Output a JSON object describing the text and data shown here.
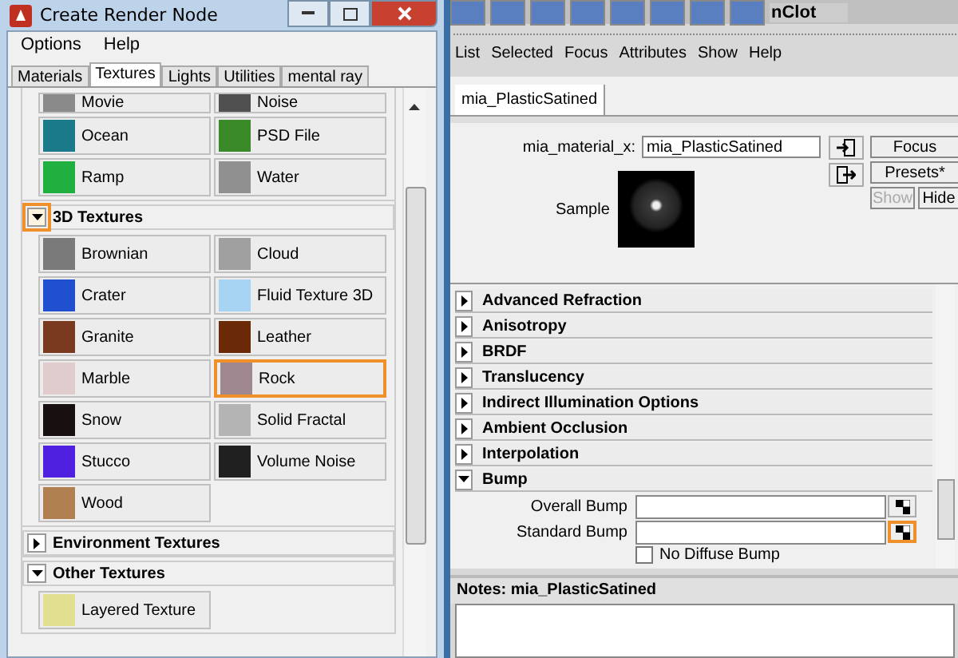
{
  "render_node_window": {
    "title": "Create Render Node",
    "menu": [
      "Options",
      "Help"
    ],
    "tabs": [
      {
        "label": "Materials",
        "selected": false
      },
      {
        "label": "Textures",
        "selected": true
      },
      {
        "label": "Lights",
        "selected": false
      },
      {
        "label": "Utilities",
        "selected": false
      },
      {
        "label": "mental ray",
        "selected": false
      }
    ],
    "sections": [
      {
        "tiles": [
          {
            "label": "Movie",
            "color": "#8a8a8a",
            "clipped": true,
            "highlighted": false
          },
          {
            "label": "Noise",
            "color": "#505050",
            "clipped": true,
            "highlighted": false
          },
          {
            "label": "Ocean",
            "color": "#1a7a8a",
            "clipped": false,
            "highlighted": false
          },
          {
            "label": "PSD File",
            "color": "#3a8a2a",
            "clipped": false,
            "highlighted": false
          },
          {
            "label": "Ramp",
            "color": "#20b040",
            "clipped": false,
            "highlighted": false
          },
          {
            "label": "Water",
            "color": "#909090",
            "clipped": false,
            "highlighted": false
          }
        ]
      },
      {
        "title": "3D Textures",
        "expanded": true,
        "highlighted": true,
        "tiles": [
          {
            "label": "Brownian",
            "color": "#7a7a7a",
            "clipped": false,
            "highlighted": false
          },
          {
            "label": "Cloud",
            "color": "#a0a0a0",
            "clipped": false,
            "highlighted": false
          },
          {
            "label": "Crater",
            "color": "#2050d0",
            "clipped": false,
            "highlighted": false
          },
          {
            "label": "Fluid Texture 3D",
            "color": "#a8d4f4",
            "clipped": false,
            "highlighted": false
          },
          {
            "label": "Granite",
            "color": "#7a3a20",
            "clipped": false,
            "highlighted": false
          },
          {
            "label": "Leather",
            "color": "#6a2a08",
            "clipped": false,
            "highlighted": false
          },
          {
            "label": "Marble",
            "color": "#e0cccc",
            "clipped": false,
            "highlighted": false
          },
          {
            "label": "Rock",
            "color": "#a08890",
            "clipped": false,
            "highlighted": true
          },
          {
            "label": "Snow",
            "color": "#181010",
            "clipped": false,
            "highlighted": false
          },
          {
            "label": "Solid Fractal",
            "color": "#b4b4b4",
            "clipped": false,
            "highlighted": false
          },
          {
            "label": "Stucco",
            "color": "#5020e0",
            "clipped": false,
            "highlighted": false
          },
          {
            "label": "Volume Noise",
            "color": "#202020",
            "clipped": false,
            "highlighted": false
          },
          {
            "label": "Wood",
            "color": "#b08050",
            "clipped": false,
            "highlighted": false
          }
        ]
      },
      {
        "title": "Environment Textures",
        "expanded": false,
        "highlighted": false
      },
      {
        "title": "Other Textures",
        "expanded": true,
        "highlighted": false,
        "tiles": [
          {
            "label": "Layered Texture",
            "color": "#e0e090",
            "clipped": false,
            "highlighted": false
          }
        ]
      }
    ]
  },
  "attribute_editor": {
    "shelf_label": "nClot",
    "menu": [
      "List",
      "Selected",
      "Focus",
      "Attributes",
      "Show",
      "Help"
    ],
    "tabs": [
      {
        "label": "mia_PlasticSatined",
        "selected": true
      }
    ],
    "material_label": "mia_material_x:",
    "material_value": "mia_PlasticSatined",
    "buttons": [
      {
        "label": "Focus",
        "disabled": false
      },
      {
        "label": "Presets*",
        "disabled": false
      },
      {
        "label": "Show",
        "disabled": true
      },
      {
        "label": "Hide",
        "disabled": false
      }
    ],
    "sample_label": "Sample",
    "sections": [
      {
        "title": "Advanced Refraction",
        "expanded": false
      },
      {
        "title": "Anisotropy",
        "expanded": false
      },
      {
        "title": "BRDF",
        "expanded": false
      },
      {
        "title": "Translucency",
        "expanded": false
      },
      {
        "title": "Indirect Illumination Options",
        "expanded": false
      },
      {
        "title": "Ambient Occlusion",
        "expanded": false
      },
      {
        "title": "Interpolation",
        "expanded": false
      },
      {
        "title": "Bump",
        "expanded": true,
        "fields": [
          {
            "label": "Overall Bump",
            "highlighted": false
          },
          {
            "label": "Standard Bump",
            "highlighted": true
          }
        ],
        "checkbox": {
          "label": "No Diffuse Bump",
          "checked": false
        }
      }
    ],
    "notes_label": "Notes:  mia_PlasticSatined"
  }
}
